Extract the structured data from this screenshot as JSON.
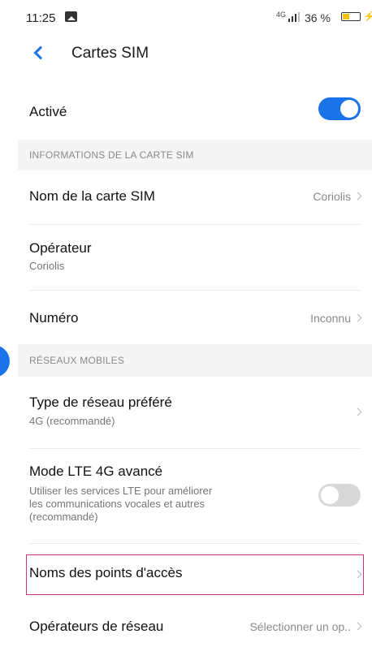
{
  "status_bar": {
    "time": "11:25",
    "network": "4G",
    "battery_percent": "36 %",
    "battery_level": 0.36,
    "charging_glyph": "⚡"
  },
  "header": {
    "back_icon": "chevron-left-icon",
    "title": "Cartes SIM"
  },
  "settings": {
    "active_label": "Activé",
    "active_on": true,
    "section_sim": "INFORMATIONS DE LA CARTE SIM",
    "sim_name_label": "Nom de la carte SIM",
    "sim_name_value": "Coriolis",
    "operator_label": "Opérateur",
    "operator_value": "Coriolis",
    "number_label": "Numéro",
    "number_value": "Inconnu",
    "section_mobile": "RÉSEAUX MOBILES",
    "network_type_label": "Type de réseau préféré",
    "network_type_value": "4G (recommandé)",
    "lte_label": "Mode LTE 4G avancé",
    "lte_desc_line1": "Utiliser les services LTE pour améliorer",
    "lte_desc_line2": "les communications vocales et autres",
    "lte_desc_line3": "(recommandé)",
    "lte_on": false,
    "apn_label": "Noms des points d'accès",
    "operators_label": "Opérateurs de réseau",
    "operators_value": "Sélectionner un op.."
  },
  "colors": {
    "accent": "#1a73e8",
    "highlight": "#d6337e",
    "toggle_off": "#d8d8d8"
  }
}
